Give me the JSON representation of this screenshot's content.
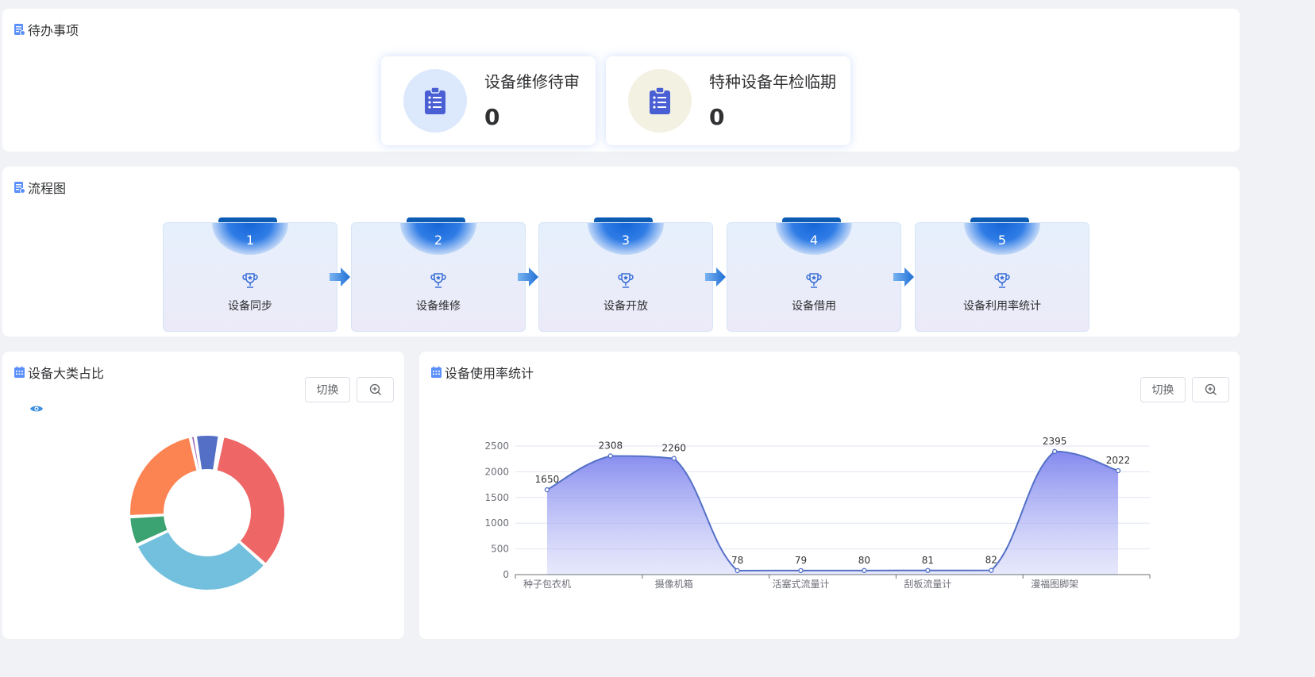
{
  "todo": {
    "title": "待办事项",
    "cards": [
      {
        "label": "设备维修待审",
        "count": "0",
        "circle_color": "#dce8fc"
      },
      {
        "label": "特种设备年检临期",
        "count": "0",
        "circle_color": "#f3f1e2"
      }
    ]
  },
  "flow": {
    "title": "流程图",
    "steps": [
      {
        "num": "1",
        "label": "设备同步"
      },
      {
        "num": "2",
        "label": "设备维修"
      },
      {
        "num": "3",
        "label": "设备开放"
      },
      {
        "num": "4",
        "label": "设备借用"
      },
      {
        "num": "5",
        "label": "设备利用率统计"
      }
    ]
  },
  "category": {
    "title": "设备大类占比",
    "switch_label": "切换",
    "zoom_icon": "zoom-in-icon",
    "legend_icon": "eye-icon",
    "chart_data": {
      "type": "pie",
      "donut": true,
      "slices": [
        {
          "value": 33,
          "color": "#ee6666"
        },
        {
          "value": 31,
          "color": "#73c0de"
        },
        {
          "value": 6,
          "color": "#3ba272"
        },
        {
          "value": 22,
          "color": "#fc8452"
        },
        {
          "value": 1,
          "color": "#9a60b4"
        },
        {
          "value": 5,
          "color": "#5470c6"
        },
        {
          "value": 0.6,
          "color": "#91cc75"
        }
      ]
    }
  },
  "usage": {
    "title": "设备使用率统计",
    "switch_label": "切换",
    "zoom_icon": "zoom-in-icon",
    "chart_data": {
      "type": "area",
      "x": [
        "种子包衣机",
        "",
        "摄像机箱",
        "",
        "活塞式流量计",
        "",
        "刮板流量计",
        "",
        "漫福图脚架",
        ""
      ],
      "values": [
        1650,
        2308,
        2260,
        78,
        79,
        80,
        81,
        82,
        2395,
        2022
      ],
      "yticks": [
        0,
        500,
        1000,
        1500,
        2000,
        2500
      ],
      "ylim": [
        0,
        2500
      ],
      "grid": true,
      "line_color": "#5470c6"
    }
  }
}
